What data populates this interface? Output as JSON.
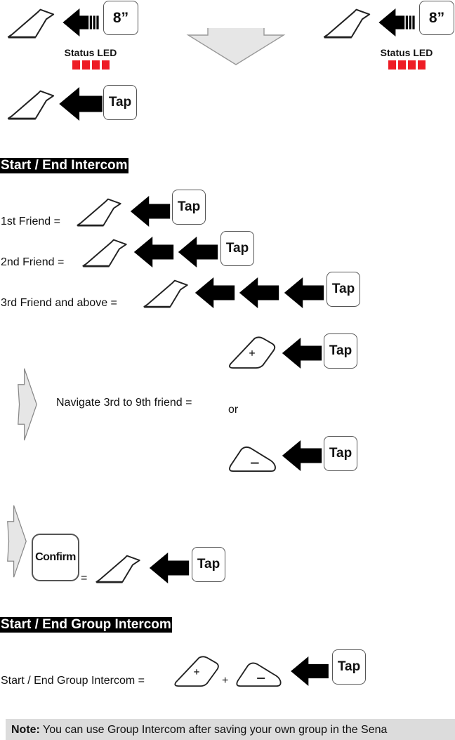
{
  "top_panel": {
    "left": {
      "key_label": "8”",
      "status_label": "Status LED",
      "led_count": 4,
      "led_color": "#ee1c25"
    },
    "right": {
      "key_label": "8”",
      "status_label": "Status LED",
      "led_count": 4,
      "led_color": "#ee1c25"
    },
    "arrow": "down-arrow",
    "tap_key_label": "Tap"
  },
  "sections": {
    "intercom": {
      "heading": "Start / End Intercom",
      "rows": [
        {
          "label": "1st Friend =",
          "arrows": 1,
          "key_label": "Tap"
        },
        {
          "label": "2nd Friend =",
          "arrows": 2,
          "key_label": "Tap"
        },
        {
          "label": "3rd Friend and above =",
          "arrows": 3,
          "key_label": "Tap"
        }
      ],
      "navigate": {
        "label": "Navigate 3rd to 9th friend =",
        "or_label": "or",
        "plus_symbol": "+",
        "minus_symbol": "−",
        "key_label": "Tap"
      },
      "confirm": {
        "key_label": "Confirm",
        "equals": "=",
        "tap_key_label": "Tap"
      }
    },
    "group_intercom": {
      "heading": "Start / End Group Intercom",
      "label": "Start / End Group Intercom =",
      "plus_symbol": "+",
      "combine": "+",
      "minus_symbol": "−",
      "key_label": "Tap"
    }
  },
  "note": {
    "prefix": "Note:",
    "text": " You can use Group Intercom after saving your own group in the Sena"
  },
  "colors": {
    "led": "#ee1c25",
    "heading_bg": "#000000",
    "note_bg": "#dcdcdc",
    "arrow_gray": "#e6e6e6"
  }
}
